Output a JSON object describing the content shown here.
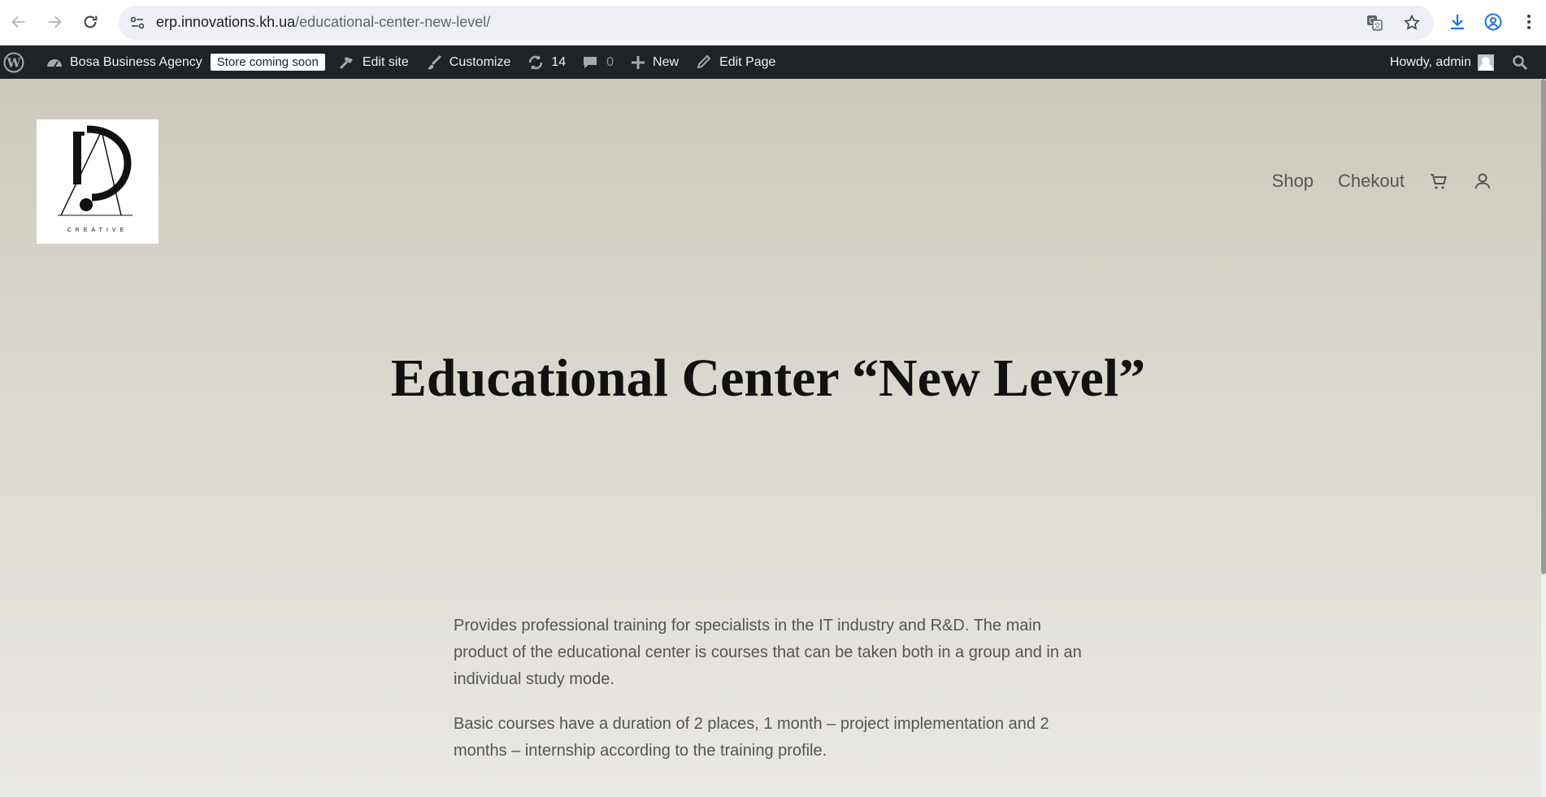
{
  "browser": {
    "url_host": "erp.innovations.kh.ua",
    "url_path": "/educational-center-new-level/"
  },
  "adminbar": {
    "site_name": "Bosa Business Agency",
    "store_badge": "Store coming soon",
    "edit_site": "Edit site",
    "customize": "Customize",
    "updates_count": "14",
    "comments_count": "0",
    "new_label": "New",
    "edit_page": "Edit Page",
    "howdy": "Howdy, admin"
  },
  "site": {
    "logo_text": "CREATIVE",
    "nav": {
      "shop": "Shop",
      "checkout": "Chekout"
    }
  },
  "content": {
    "title": "Educational Center “New Level”",
    "paragraph1": "Provides professional training for specialists in the IT industry and R&D. The main product of the educational center is courses that can be taken both in a group and in an individual study mode.",
    "paragraph2": "Basic courses have a duration of 2 places, 1 month – project implementation and 2 months – internship according to the training profile."
  }
}
